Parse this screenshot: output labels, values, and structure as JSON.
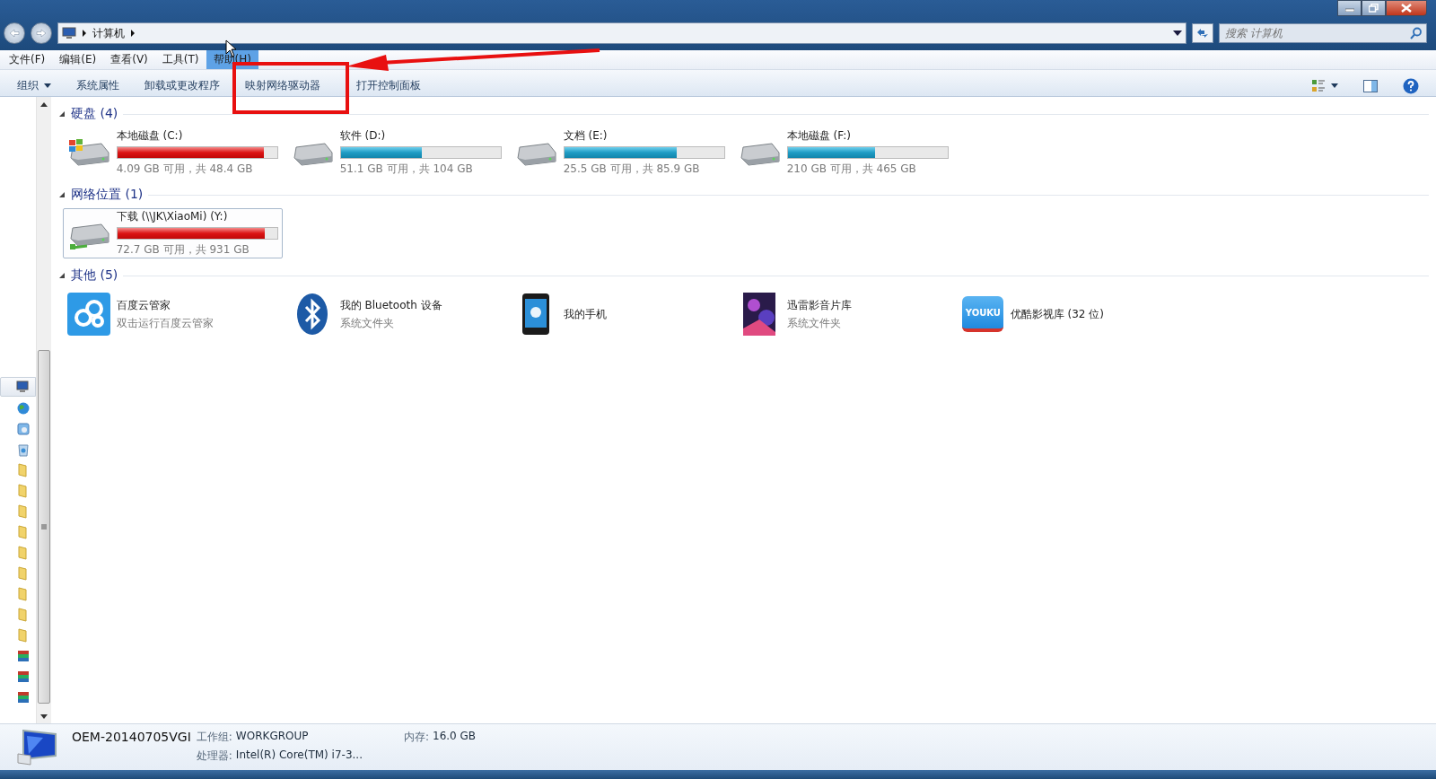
{
  "address": {
    "path": [
      "计算机"
    ]
  },
  "search": {
    "placeholder": "搜索 计算机"
  },
  "menu": [
    {
      "label": "文件(F)",
      "selected": false
    },
    {
      "label": "编辑(E)",
      "selected": false
    },
    {
      "label": "查看(V)",
      "selected": false
    },
    {
      "label": "工具(T)",
      "selected": false
    },
    {
      "label": "帮助(H)",
      "selected": true
    }
  ],
  "toolbar": [
    {
      "label": "组织",
      "kind": "dropdown"
    },
    {
      "label": "系统属性",
      "kind": "button"
    },
    {
      "label": "卸载或更改程序",
      "kind": "button"
    },
    {
      "label": "映射网络驱动器",
      "kind": "button"
    },
    {
      "label": "打开控制面板",
      "kind": "button"
    }
  ],
  "nav_items": [
    {
      "kind": "computer",
      "selected": true
    },
    {
      "kind": "network",
      "selected": false
    },
    {
      "kind": "control_panel",
      "selected": false
    },
    {
      "kind": "recycle_bin",
      "selected": false
    },
    {
      "kind": "folder",
      "selected": false
    },
    {
      "kind": "folder",
      "selected": false
    },
    {
      "kind": "folder",
      "selected": false
    },
    {
      "kind": "folder",
      "selected": false
    },
    {
      "kind": "folder",
      "selected": false
    },
    {
      "kind": "folder",
      "selected": false
    },
    {
      "kind": "folder",
      "selected": false
    },
    {
      "kind": "folder",
      "selected": false
    },
    {
      "kind": "folder",
      "selected": false
    },
    {
      "kind": "archive",
      "selected": false
    },
    {
      "kind": "archive",
      "selected": false
    },
    {
      "kind": "archive",
      "selected": false
    }
  ],
  "groups": [
    {
      "title": "硬盘 (4)",
      "expanded": true,
      "items": [
        {
          "kind": "system_drive",
          "name": "本地磁盘 (C:)",
          "level": 0.915,
          "detail": "4.09 GB 可用，共 48.4 GB",
          "selected": false
        },
        {
          "kind": "drive",
          "name": "软件 (D:)",
          "level": 0.509,
          "detail": "51.1 GB 可用，共 104 GB",
          "selected": false
        },
        {
          "kind": "drive",
          "name": "文档 (E:)",
          "level": 0.703,
          "detail": "25.5 GB 可用，共 85.9 GB",
          "selected": false
        },
        {
          "kind": "drive",
          "name": "本地磁盘 (F:)",
          "level": 0.548,
          "detail": "210 GB 可用，共 465 GB",
          "selected": false
        }
      ]
    },
    {
      "title": "网络位置 (1)",
      "expanded": true,
      "items": [
        {
          "kind": "network_drive",
          "name": "下载 (\\\\JK\\XiaoMi) (Y:)",
          "level": 0.922,
          "detail": "72.7 GB 可用，共 931 GB",
          "selected": true
        }
      ]
    },
    {
      "title": "其他 (5)",
      "expanded": true,
      "items": [
        {
          "kind": "cloud_app",
          "name": "百度云管家",
          "detail": "双击运行百度云管家",
          "selected": false
        },
        {
          "kind": "bluetooth",
          "name": "我的 Bluetooth 设备",
          "detail": "系统文件夹",
          "selected": false
        },
        {
          "kind": "phone",
          "name": "我的手机",
          "selected": false
        },
        {
          "kind": "video_library",
          "name": "迅雷影音片库",
          "detail": "系统文件夹",
          "selected": false
        },
        {
          "kind": "video_folder",
          "name": "优酷影视库 (32 位)",
          "icon_text": "YOUKU",
          "selected": false
        }
      ]
    }
  ],
  "status": {
    "computer_name": "OEM-20140705VGI",
    "fields": [
      {
        "label": "工作组:",
        "value": "WORKGROUP"
      },
      {
        "label": "内存:",
        "value": "16.0 GB"
      },
      {
        "label": "处理器:",
        "value": "Intel(R) Core(TM) i7-3..."
      }
    ]
  }
}
